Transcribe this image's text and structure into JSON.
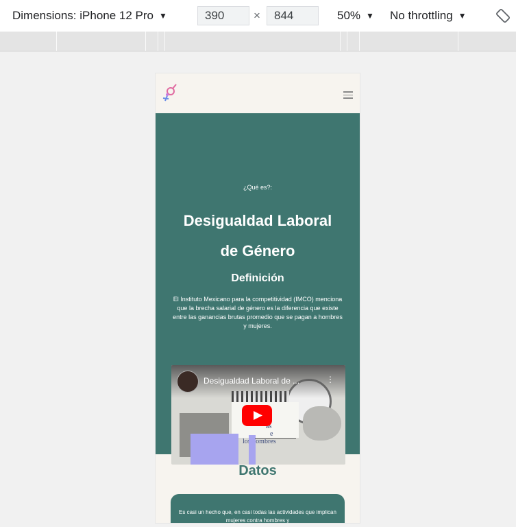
{
  "devtools": {
    "dimensions_label": "Dimensions: iPhone 12 Pro",
    "width_value": "390",
    "times_sign": "×",
    "height_value": "844",
    "zoom": "50%",
    "throttling": "No throttling",
    "caret": "▼"
  },
  "site": {
    "header": {
      "menu_icon": "hamburger-icon",
      "logo_icon": "gender-symbol-logo"
    },
    "hero": {
      "eyebrow": "¿Qué es?:",
      "title_line1": "Desigualdad Laboral",
      "title_line2": "de Género",
      "definition_title": "Definición",
      "definition_text": "El Instituto Mexicano para la competitividad (IMCO) menciona que la brecha salarial de género es la diferencia que existe entre las ganancias brutas promedio que se pagan a hombres y mujeres."
    },
    "video": {
      "title": "Desigualdad Laboral de ...",
      "more_icon": "⋮",
      "overlay_text_1": "ás",
      "overlay_text_2": "e",
      "overlay_text_3": "los hombres",
      "play_icon": "youtube-play-icon"
    },
    "datos": {
      "title": "Datos",
      "text": "Es casi un hecho que, en casi todas las actividades que implican mujeres contra hombres y"
    }
  },
  "colors": {
    "teal": "#3f7670",
    "page_bg": "#f7f4ef",
    "youtube_red": "#ff0000"
  }
}
